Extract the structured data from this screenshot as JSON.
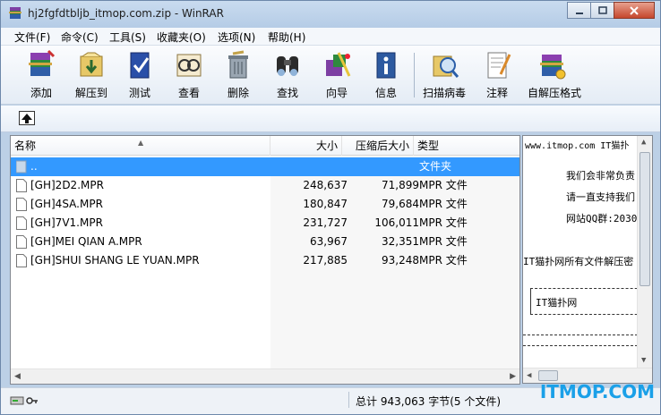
{
  "window": {
    "title": "hj2fgfdtbljb_itmop.com.zip - WinRAR"
  },
  "menu": [
    "文件(F)",
    "命令(C)",
    "工具(S)",
    "收藏夹(O)",
    "选项(N)",
    "帮助(H)"
  ],
  "toolbar": [
    {
      "label": "添加",
      "icon": "add-archive-icon"
    },
    {
      "label": "解压到",
      "icon": "extract-to-icon"
    },
    {
      "label": "测试",
      "icon": "test-icon"
    },
    {
      "label": "查看",
      "icon": "view-icon"
    },
    {
      "label": "删除",
      "icon": "delete-icon"
    },
    {
      "label": "查找",
      "icon": "find-icon"
    },
    {
      "label": "向导",
      "icon": "wizard-icon"
    },
    {
      "label": "信息",
      "icon": "info-icon"
    },
    {
      "label": "扫描病毒",
      "icon": "virus-scan-icon"
    },
    {
      "label": "注释",
      "icon": "comment-icon"
    },
    {
      "label": "自解压格式",
      "icon": "sfx-icon"
    }
  ],
  "columns": {
    "name": "名称",
    "size": "大小",
    "packed": "压缩后大小",
    "type": "类型"
  },
  "files": [
    {
      "name": "..",
      "size": "",
      "packed": "",
      "type": "文件夹",
      "selected": true
    },
    {
      "name": "[GH]2D2.MPR",
      "size": "248,637",
      "packed": "71,899",
      "type": "MPR 文件"
    },
    {
      "name": "[GH]4SA.MPR",
      "size": "180,847",
      "packed": "79,684",
      "type": "MPR 文件"
    },
    {
      "name": "[GH]7V1.MPR",
      "size": "231,727",
      "packed": "106,011",
      "type": "MPR 文件"
    },
    {
      "name": "[GH]MEI QIAN A.MPR",
      "size": "63,967",
      "packed": "32,351",
      "type": "MPR 文件"
    },
    {
      "name": "[GH]SHUI SHANG LE YUAN.MPR",
      "size": "217,885",
      "packed": "93,248",
      "type": "MPR 文件"
    }
  ],
  "comment": {
    "line1": "www.itmop.com  IT猫扑",
    "line2": "我们会非常负责",
    "line3": "请一直支持我们",
    "line4": "网站QQ群:2030",
    "line5": "IT猫扑网所有文件解压密",
    "box": "IT猫扑网"
  },
  "status": {
    "summary": "总计 943,063 字节(5 个文件)"
  },
  "watermark": "ITMOP.COM",
  "colors": {
    "selection": "#3399ff",
    "accent_watermark": "#1aa0e8"
  }
}
